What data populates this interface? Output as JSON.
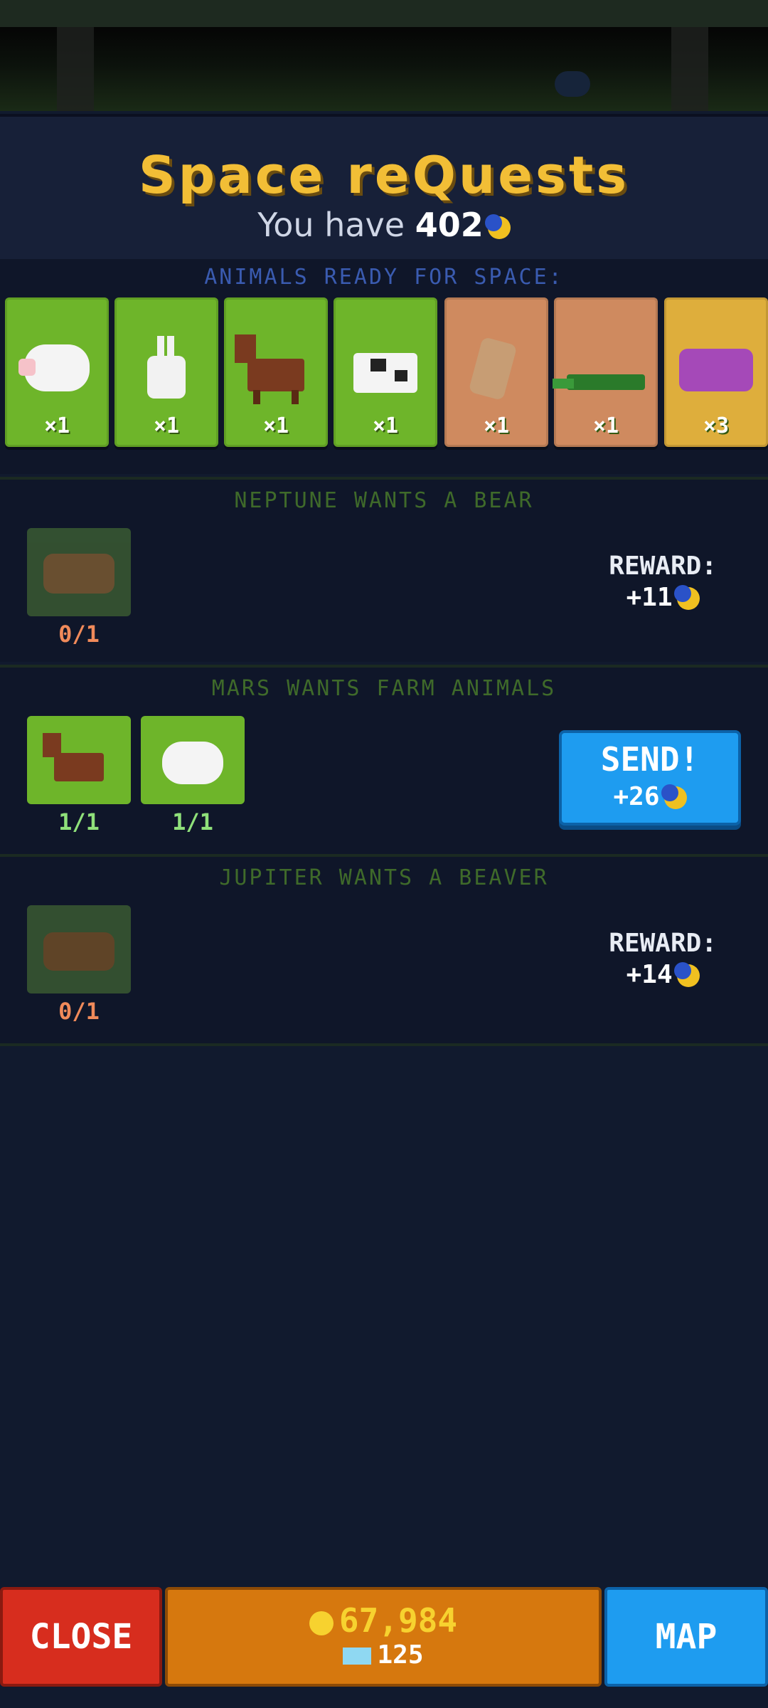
{
  "title": "Space reQuests",
  "balance": {
    "prefix": "You have",
    "amount": "402",
    "icon": "moon-coin-icon"
  },
  "ready": {
    "title": "ANIMALS READY FOR SPACE:",
    "animals": [
      {
        "name": "sheep",
        "count": "×1",
        "color": "#6eb52a"
      },
      {
        "name": "rabbit",
        "count": "×1",
        "color": "#6eb52a"
      },
      {
        "name": "horse",
        "count": "×1",
        "color": "#6eb52a"
      },
      {
        "name": "cow",
        "count": "×1",
        "color": "#6eb52a"
      },
      {
        "name": "kangaroo",
        "count": "×1",
        "color": "#cf8a5f"
      },
      {
        "name": "crocodile",
        "count": "×1",
        "color": "#cf8a5f"
      },
      {
        "name": "hippo",
        "count": "×3",
        "color": "#deae3c"
      }
    ]
  },
  "quests": [
    {
      "title": "NEPTUNE WANTS A BEAR",
      "items": [
        {
          "animal": "bear",
          "progress": "0/1"
        }
      ],
      "reward_label": "REWARD:",
      "reward": "+11"
    },
    {
      "title": "MARS WANTS FARM ANIMALS",
      "items": [
        {
          "animal": "horse",
          "progress": "1/1"
        },
        {
          "animal": "sheep",
          "progress": "1/1"
        }
      ],
      "send_label": "SEND!",
      "reward": "+26"
    },
    {
      "title": "JUPITER WANTS A BEAVER",
      "items": [
        {
          "animal": "beaver",
          "progress": "0/1"
        }
      ],
      "reward_label": "REWARD:",
      "reward": "+14"
    }
  ],
  "bottom": {
    "close_label": "CLOSE",
    "gold": "67,984",
    "gems": "125",
    "map_label": "MAP"
  }
}
